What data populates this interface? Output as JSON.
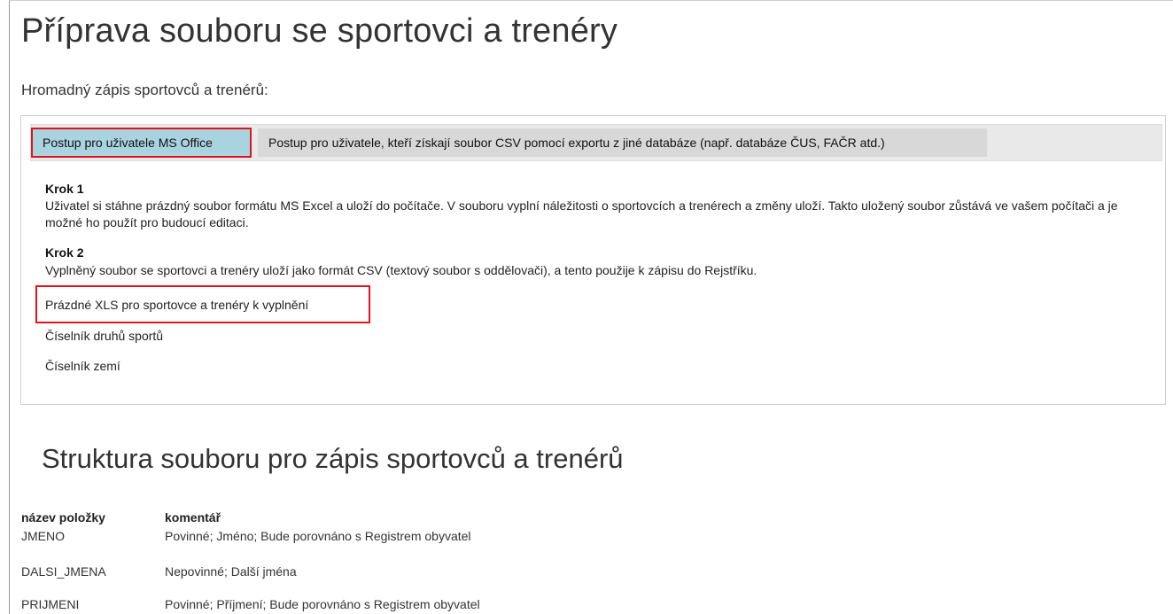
{
  "page": {
    "title": "Příprava souboru se sportovci a trenéry",
    "subtitle": "Hromadný zápis sportovců a trenérů:"
  },
  "tabs": {
    "ms_office": "Postup pro uživatele MS Office",
    "csv": "Postup pro uživatele, kteří získají soubor CSV pomocí exportu z jiné databáze (např. databáze ČUS, FAČR atd.)"
  },
  "steps": {
    "step1_title": "Krok 1",
    "step1_text": "Uživatel si stáhne prázdný soubor formátu MS Excel a uloží do počítače. V souboru vyplní náležitosti o sportovcích a trenérech a změny uloží. Takto uložený soubor zůstává ve vašem počítači a je možné ho použít pro budoucí editaci.",
    "step2_title": "Krok 2",
    "step2_text": "Vyplněný soubor se sportovci a trenéry uloží jako formát CSV (textový soubor s oddělovači), a tento použije k zápisu do Rejstříku."
  },
  "links": {
    "xls": "Prázdné XLS pro sportovce a trenéry k vyplnění",
    "sports": "Číselník druhů sportů",
    "countries": "Číselník zemí"
  },
  "structure": {
    "heading": "Struktura souboru pro zápis sportovců a trenérů",
    "col_name": "název položky",
    "col_comment": "komentář",
    "rows": [
      {
        "name": "JMENO",
        "comment": "Povinné; Jméno; Bude porovnáno s Registrem obyvatel"
      },
      {
        "name": "DALSI_JMENA",
        "comment": "Nepovinné; Další jména"
      },
      {
        "name": "PRIJMENI",
        "comment": "Povinné; Příjmení; Bude porovnáno s Registrem obyvatel"
      }
    ]
  },
  "colors": {
    "highlight": "#e0141b",
    "active_tab": "#a8d3df",
    "inactive_tab": "#d8d8d8"
  }
}
